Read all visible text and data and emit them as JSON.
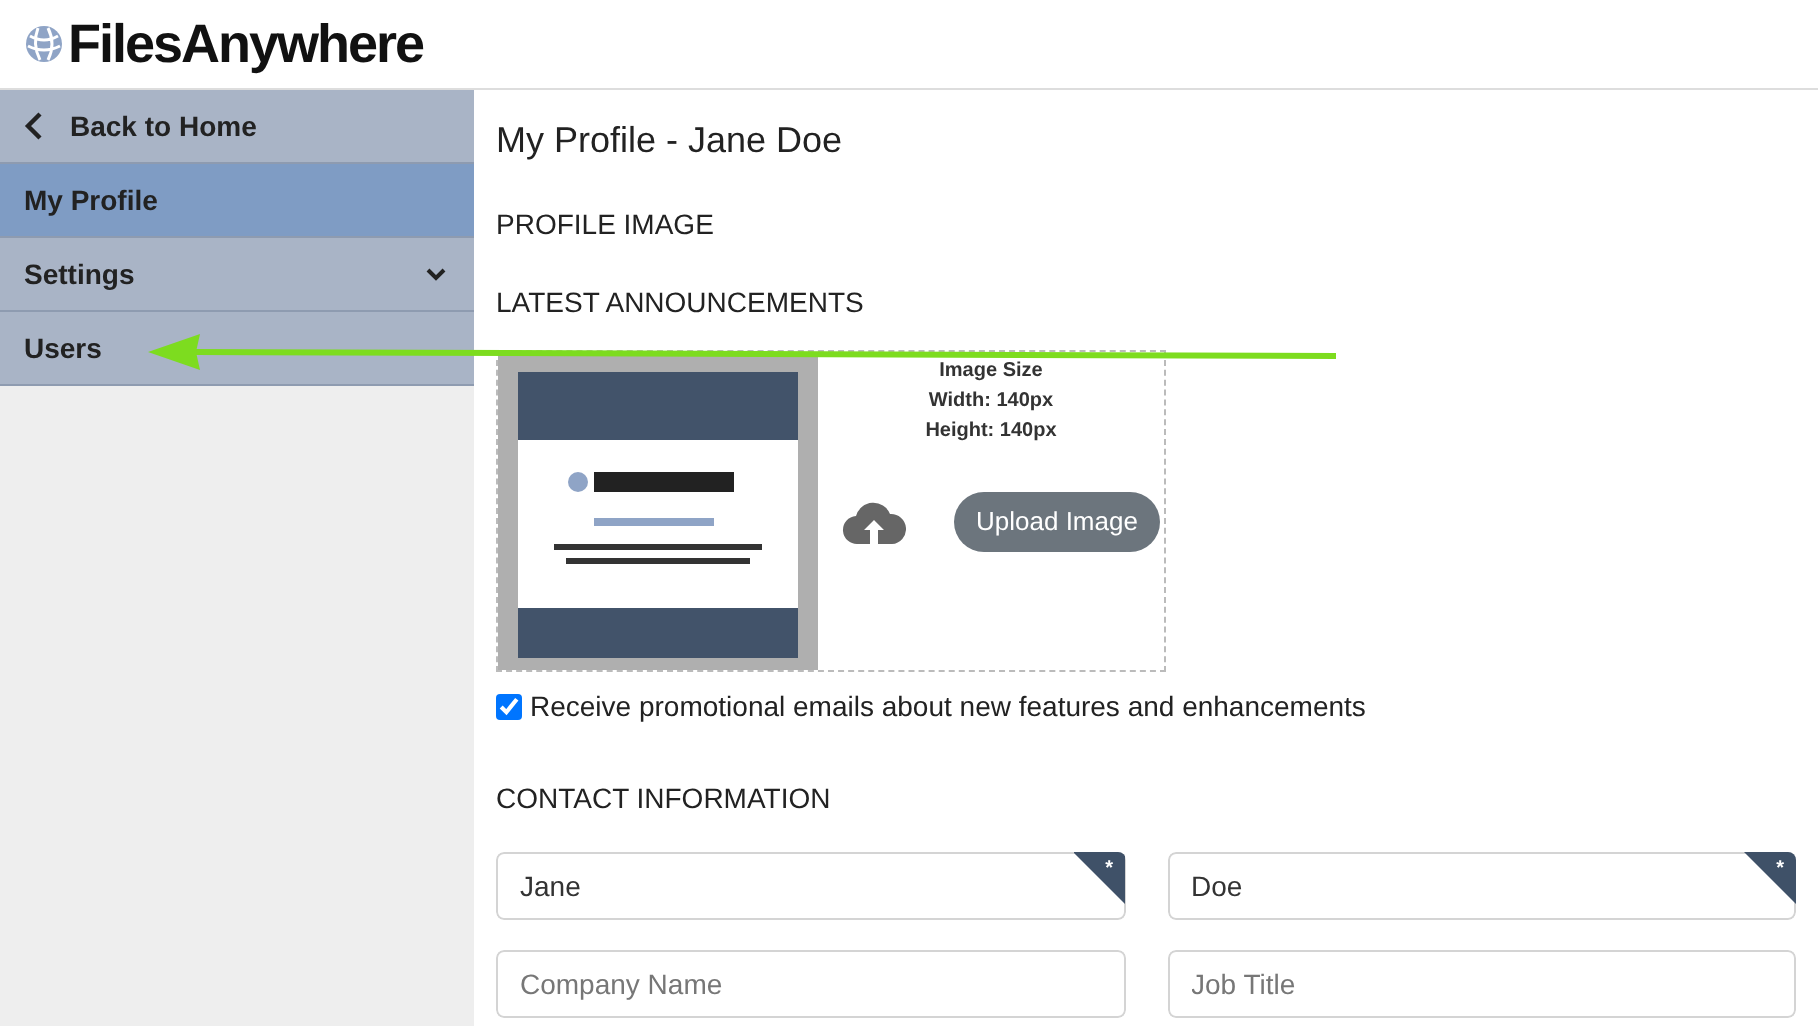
{
  "header": {
    "logo_text": "FilesAnywhere"
  },
  "sidebar": {
    "items": [
      {
        "kind": "back",
        "label": "Back to Home",
        "selected": false
      },
      {
        "kind": "item",
        "label": "My Profile",
        "selected": true
      },
      {
        "kind": "group",
        "label": "Settings",
        "selected": false,
        "expanded": false
      },
      {
        "kind": "item",
        "label": "Users",
        "selected": false
      }
    ]
  },
  "page": {
    "title": "My Profile - Jane Doe",
    "sections": [
      "PROFILE IMAGE",
      "LATEST ANNOUNCEMENTS"
    ],
    "image_panel": {
      "size_lines": [
        "Image Size",
        "Width: 140px",
        "Height: 140px"
      ],
      "upload_button": "Upload Image"
    },
    "promo_checkbox": {
      "label": "Receive promotional emails about new features and enhancements",
      "checked": true
    },
    "contact_heading": "CONTACT INFORMATION",
    "fields": [
      {
        "value": "Jane",
        "required": true,
        "required_mark": "*"
      },
      {
        "value": "Doe",
        "required": true,
        "required_mark": "*"
      },
      {
        "placeholder": "Company Name",
        "required": false
      },
      {
        "placeholder": "Job Title",
        "required": false
      }
    ]
  }
}
